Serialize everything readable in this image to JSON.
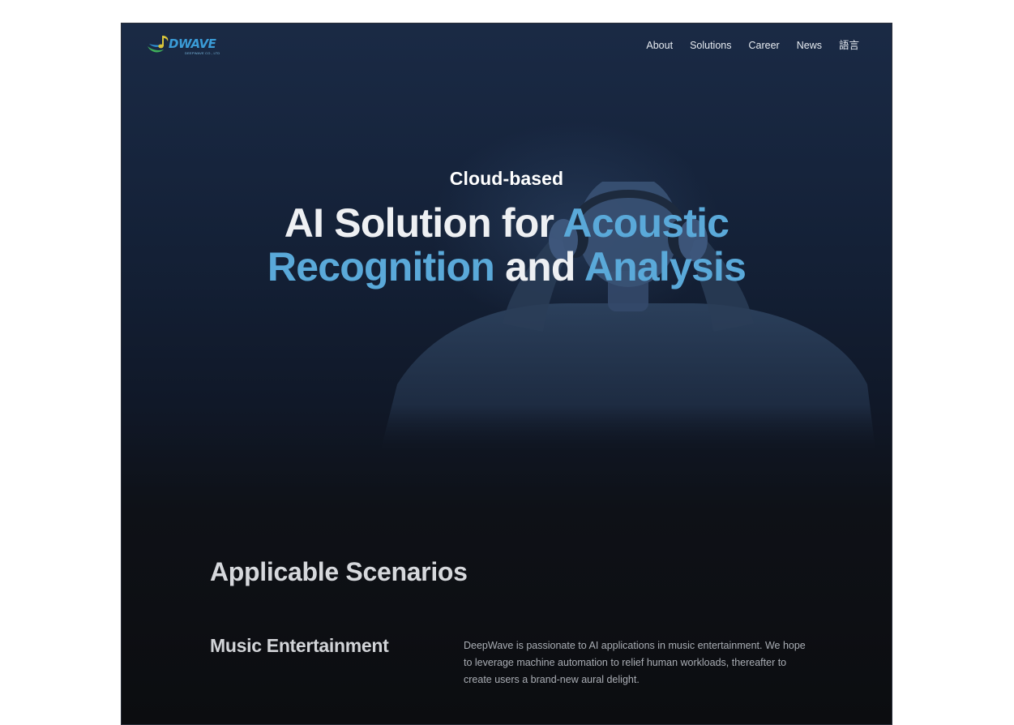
{
  "brand": {
    "name": "DWAVE",
    "tagline": "DEEPWAVE CO., LTD"
  },
  "nav": {
    "items": [
      {
        "label": "About"
      },
      {
        "label": "Solutions"
      },
      {
        "label": "Career"
      },
      {
        "label": "News"
      },
      {
        "label": "語言"
      }
    ]
  },
  "hero": {
    "kicker": "Cloud-based",
    "title_part1": "AI Solution for ",
    "title_accent1": "Acoustic",
    "title_accent2": "Recognition",
    "title_part2": " and ",
    "title_accent3": "Analysis"
  },
  "scenarios": {
    "title": "Applicable Scenarios",
    "items": [
      {
        "name": "Music Entertainment",
        "description": "DeepWave is passionate to AI applications in music entertainment. We hope to leverage machine automation to relief human workloads, thereafter to create users a brand-new aural delight."
      }
    ]
  },
  "colors": {
    "accent": "#5aa9d9",
    "background_top": "#1a2a45",
    "background_bottom": "#0c0d10"
  }
}
